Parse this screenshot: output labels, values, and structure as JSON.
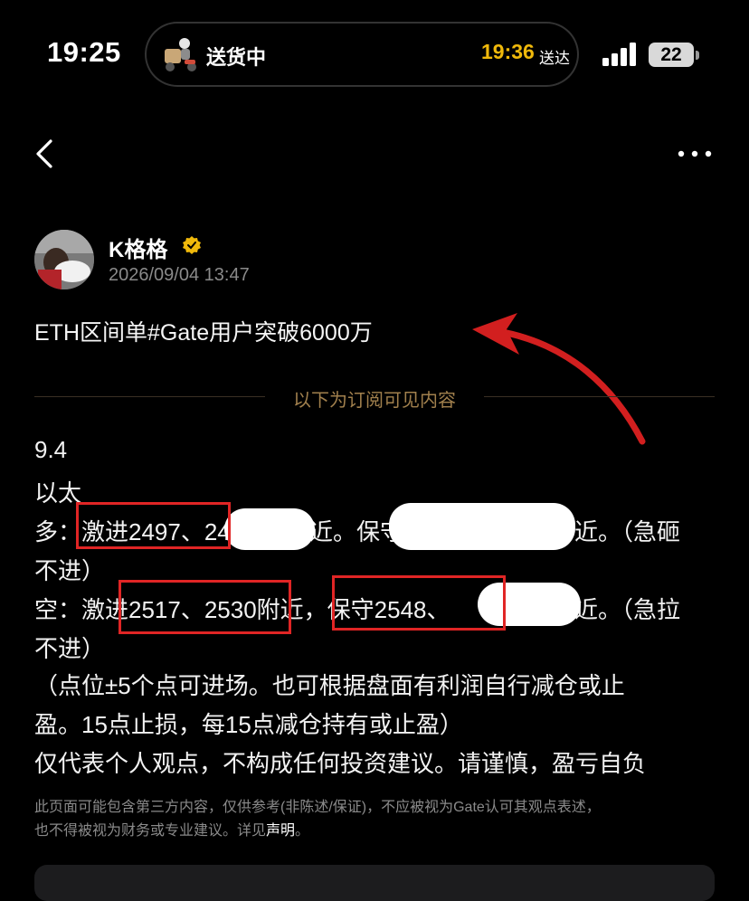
{
  "status_bar": {
    "time": "19:25",
    "island_status": "送货中",
    "eta_time": "19:36",
    "eta_suffix": "送达",
    "battery": "22"
  },
  "nav": {
    "back_icon": "chevron-left-icon",
    "more_icon": "more-horizontal-icon"
  },
  "author": {
    "name": "K格格",
    "time": "2026/09/04 13:47",
    "verified_icon": "verified-badge-icon"
  },
  "post": {
    "title": "ETH区间单#Gate用户突破6000万",
    "subscriber_divider": "以下为订阅可见内容",
    "lines": [
      "9.4",
      "以太",
      "多：激进2497、24",
      "近。保守",
      "近。（急砸",
      "不进）",
      "空：激进2517、2530附近，保守2548、",
      "近。（急拉",
      "不进）",
      "（点位±5个点可进场。也可根据盘面有利润自行减仓或止",
      "盈。15点止损，每15点减仓持有或止盈）",
      "仅代表个人观点，不构成任何投资建议。请谨慎，盈亏自负"
    ]
  },
  "disclaimer": {
    "line1": "此页面可能包含第三方内容，仅供参考(非陈述/保证)，不应被视为Gate认可其观点表述，",
    "line2": "也不得被视为财务或专业建议。详见",
    "link": "声明",
    "end": "。"
  },
  "colors": {
    "accent": "#f0b90b",
    "annotation_red": "#e02525",
    "divider_text": "#a1804d"
  }
}
